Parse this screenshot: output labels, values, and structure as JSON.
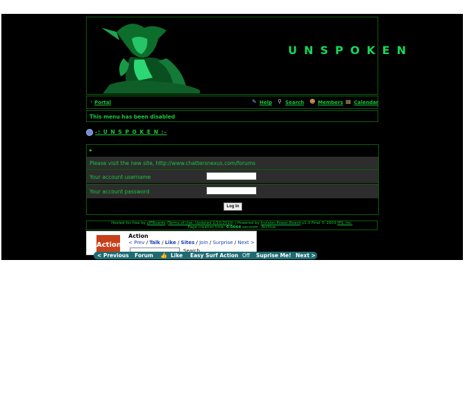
{
  "banner": {
    "title": "UNSPOKEN"
  },
  "nav": {
    "portal": "Portal",
    "help": "Help",
    "search": "Search",
    "members": "Members",
    "calendar": "Calendar"
  },
  "menu_disabled": "This menu has been disabled",
  "breadcrumb": "-: U N S P O K E N :-",
  "login": {
    "notice": "Please visit the new site, http://www.chattersnexus.com/forums",
    "username_label": "Your account username",
    "password_label": "Your account password",
    "username_value": "",
    "password_value": "",
    "button": "Log In"
  },
  "footer": {
    "hosted_prefix": "Hosted for free by",
    "host": "zIFBoards",
    "terms": "Terms of Use: Updated 2/10/2010",
    "powered_prefix": "| Powered by",
    "ipb": "Invision Power Board",
    "ipb_version": "v1.3 Final © 2003",
    "ips": "IPS, Inc.",
    "gen_prefix": "Page creation time:",
    "gen_time": "0.0064",
    "gen_suffix": "seconds · Archive"
  },
  "ad": {
    "logo_text": "Action",
    "title": "Action",
    "links": [
      "< Prev",
      "Talk",
      "Like",
      "Sites",
      "Join",
      "Surprise",
      "Next >"
    ],
    "search_label": "Search"
  },
  "surfbar": {
    "previous": "< Previous",
    "forum": "Forum",
    "like": "Like",
    "easy_surf": "Easy Surf Action",
    "off": "Off",
    "surprise": "Suprise Me!",
    "next": "Next >"
  },
  "colors": {
    "accent": "#18c93c",
    "surfbar": "#1f6b72"
  }
}
